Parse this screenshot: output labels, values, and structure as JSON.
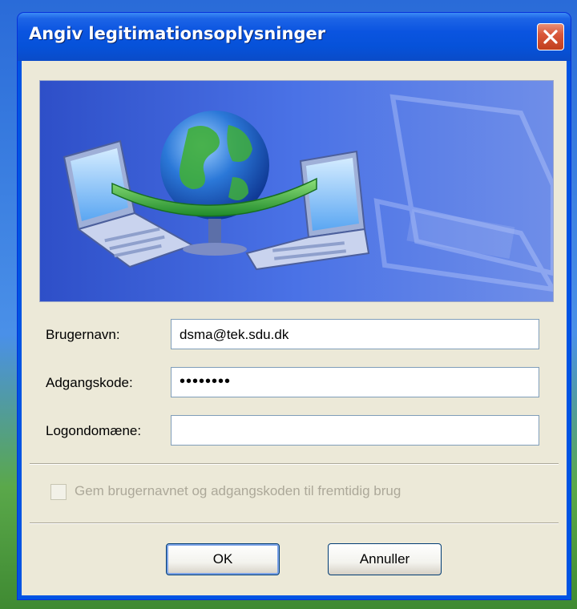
{
  "window": {
    "title": "Angiv legitimationsoplysninger"
  },
  "form": {
    "username": {
      "label": "Brugernavn:",
      "value": "dsma@tek.sdu.dk"
    },
    "password": {
      "label": "Adgangskode:",
      "value": "••••••••"
    },
    "domain": {
      "label": "Logondomæne:",
      "value": ""
    }
  },
  "remember": {
    "label": "Gem brugernavnet og adgangskoden til fremtidig brug",
    "checked": false,
    "enabled": false
  },
  "buttons": {
    "ok": "OK",
    "cancel": "Annuller"
  },
  "colors": {
    "title_bar": "#0a54e0",
    "dialog_bg": "#ece9d8",
    "close_button": "#d9573a",
    "banner": "#3a64d8"
  }
}
